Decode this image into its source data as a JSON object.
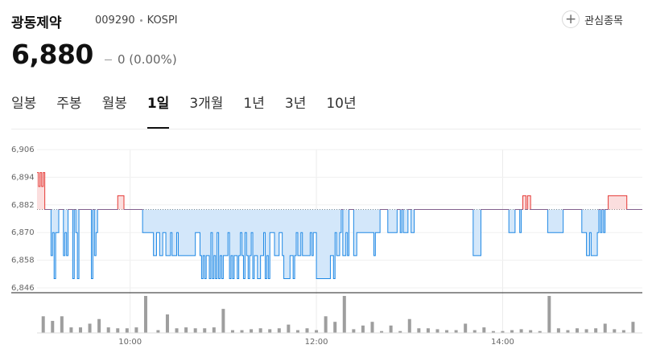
{
  "stock": {
    "name": "광동제약",
    "code": "009290",
    "market": "KOSPI",
    "price": "6,880",
    "change": "0 (0.00%)"
  },
  "actions": {
    "watchlist_label": "관심종목"
  },
  "tabs": [
    {
      "label": "일봉",
      "active": false
    },
    {
      "label": "주봉",
      "active": false
    },
    {
      "label": "월봉",
      "active": false
    },
    {
      "label": "1일",
      "active": true
    },
    {
      "label": "3개월",
      "active": false
    },
    {
      "label": "1년",
      "active": false
    },
    {
      "label": "3년",
      "active": false
    },
    {
      "label": "10년",
      "active": false
    }
  ],
  "colors": {
    "up": "#e53935",
    "down": "#1e88e5",
    "down_fill": "#d3e7fa",
    "up_fill": "#fbdede",
    "volume": "#9e9e9e"
  },
  "chart_data": {
    "type": "line",
    "title": "",
    "reference_price": 6880,
    "y_ticks": [
      "6,906",
      "6,894",
      "6,882",
      "6,870",
      "6,858",
      "6,846"
    ],
    "x_ticks": [
      "10:00",
      "12:00",
      "14:00"
    ],
    "ylim": [
      6846,
      6906
    ],
    "xlim": [
      "09:00",
      "15:30"
    ],
    "grid": true,
    "price_series": {
      "name": "",
      "x": [
        0,
        1,
        2,
        3,
        4,
        5,
        6,
        7,
        8,
        9,
        10,
        11,
        12,
        13,
        14,
        15,
        16,
        17,
        18,
        19,
        20,
        21,
        22,
        23,
        24,
        25,
        26,
        27,
        28,
        29,
        30,
        31,
        32,
        33,
        34,
        35,
        36,
        37,
        38,
        39,
        40,
        41,
        42,
        43,
        44,
        45,
        46,
        47,
        48,
        49,
        50,
        51,
        52,
        53,
        54,
        55,
        56,
        57,
        58,
        59,
        60,
        61,
        62,
        63,
        64,
        65,
        66,
        67,
        68,
        69,
        70,
        71,
        72,
        73,
        74,
        75,
        76,
        77,
        78,
        79,
        80,
        81,
        82,
        83,
        84,
        85,
        86,
        87,
        88,
        89,
        90,
        91,
        92,
        93,
        94,
        95,
        96,
        97,
        98,
        99,
        100,
        101,
        102,
        103,
        104,
        105,
        106,
        107,
        108,
        109,
        110,
        111,
        112,
        113,
        114,
        115,
        116,
        117,
        118,
        119,
        120,
        121,
        122,
        123,
        124,
        125,
        126,
        127,
        128,
        129,
        130,
        131,
        132,
        133,
        134,
        135,
        136,
        137,
        138,
        139,
        140,
        141,
        142,
        143,
        144,
        145,
        146,
        147,
        148,
        149,
        150,
        151,
        152,
        153,
        154,
        155,
        156,
        157,
        158,
        159,
        160,
        161,
        162,
        163,
        164,
        165,
        166,
        167,
        168,
        169,
        170,
        171,
        172,
        173,
        174,
        175,
        176,
        177,
        178,
        179,
        180,
        181,
        182,
        183,
        184,
        185,
        186,
        187,
        188,
        189,
        190,
        191,
        192,
        193,
        194,
        195,
        196,
        197,
        198,
        199,
        200,
        201,
        202,
        203,
        204,
        205,
        206,
        207,
        208,
        209,
        210,
        211,
        212,
        213,
        214,
        215,
        216,
        217,
        218,
        219,
        220,
        221,
        222,
        223,
        224,
        225,
        226,
        227,
        228,
        229,
        230,
        231,
        232,
        233,
        234,
        235,
        236,
        237,
        238,
        239,
        240,
        241,
        242,
        243,
        244,
        245,
        246,
        247,
        248,
        249,
        250,
        251,
        252,
        253,
        254,
        255,
        256,
        257,
        258,
        259,
        260,
        261,
        262,
        263,
        264,
        265,
        266,
        267,
        268,
        269,
        270,
        271,
        272,
        273,
        274,
        275,
        276,
        277,
        278,
        279,
        280,
        281,
        282,
        283,
        284,
        285,
        286,
        287,
        288,
        289,
        290,
        291,
        292,
        293,
        294,
        295,
        296,
        297,
        298,
        299,
        300,
        301,
        302,
        303,
        304,
        305,
        306,
        307,
        308,
        309,
        310,
        311,
        312,
        313,
        314,
        315,
        316,
        317,
        318,
        319,
        320,
        321,
        322,
        323,
        324,
        325,
        326,
        327,
        328,
        329,
        330,
        331,
        332,
        333,
        334,
        335,
        336,
        337,
        338,
        339,
        340,
        341,
        342,
        343,
        344,
        345,
        346,
        347,
        348,
        349,
        350,
        351,
        352,
        353,
        354,
        355,
        356,
        357,
        358,
        359,
        360,
        361,
        362,
        363,
        364,
        365,
        366,
        367,
        368,
        369,
        370,
        371,
        372,
        373,
        374,
        375,
        376,
        377,
        378,
        379,
        380,
        381,
        382,
        383,
        384,
        385,
        386,
        387,
        388,
        389,
        390
      ],
      "y": [
        6896,
        6890,
        6896,
        6890,
        6896,
        6880,
        6880,
        6880,
        6880,
        6860,
        6870,
        6850,
        6870,
        6870,
        6880,
        6880,
        6880,
        6860,
        6870,
        6860,
        6880,
        6880,
        6880,
        6850,
        6880,
        6870,
        6850,
        6880,
        6880,
        6880,
        6880,
        6880,
        6880,
        6880,
        6880,
        6850,
        6880,
        6860,
        6870,
        6880,
        6880,
        6880,
        6880,
        6880,
        6880,
        6880,
        6880,
        6880,
        6880,
        6880,
        6880,
        6880,
        6886,
        6886,
        6886,
        6886,
        6880,
        6880,
        6880,
        6880,
        6880,
        6880,
        6880,
        6880,
        6880,
        6880,
        6880,
        6880,
        6870,
        6870,
        6870,
        6870,
        6870,
        6870,
        6870,
        6860,
        6860,
        6870,
        6870,
        6860,
        6860,
        6870,
        6870,
        6860,
        6860,
        6860,
        6870,
        6860,
        6860,
        6860,
        6870,
        6860,
        6860,
        6860,
        6860,
        6860,
        6860,
        6860,
        6860,
        6860,
        6860,
        6860,
        6870,
        6870,
        6870,
        6860,
        6850,
        6860,
        6850,
        6860,
        6860,
        6850,
        6870,
        6850,
        6860,
        6850,
        6870,
        6850,
        6860,
        6850,
        6860,
        6860,
        6860,
        6870,
        6850,
        6860,
        6850,
        6860,
        6860,
        6850,
        6860,
        6870,
        6860,
        6850,
        6870,
        6860,
        6850,
        6860,
        6870,
        6850,
        6860,
        6860,
        6850,
        6850,
        6860,
        6860,
        6870,
        6850,
        6860,
        6850,
        6870,
        6870,
        6870,
        6860,
        6860,
        6860,
        6870,
        6870,
        6860,
        6850,
        6850,
        6850,
        6850,
        6860,
        6860,
        6850,
        6860,
        6870,
        6860,
        6860,
        6870,
        6860,
        6860,
        6860,
        6860,
        6860,
        6870,
        6860,
        6870,
        6870,
        6850,
        6850,
        6850,
        6850,
        6850,
        6850,
        6850,
        6850,
        6850,
        6860,
        6860,
        6850,
        6870,
        6860,
        6860,
        6870,
        6880,
        6860,
        6860,
        6870,
        6860,
        6880,
        6880,
        6880,
        6860,
        6860,
        6870,
        6870,
        6870,
        6870,
        6870,
        6870,
        6870,
        6870,
        6870,
        6870,
        6870,
        6860,
        6870,
        6870,
        6870,
        6880,
        6880,
        6880,
        6880,
        6880,
        6870,
        6870,
        6870,
        6870,
        6870,
        6870,
        6880,
        6880,
        6870,
        6880,
        6870,
        6870,
        6870,
        6880,
        6880,
        6870,
        6870,
        6880,
        6880,
        6880,
        6880,
        6880,
        6880,
        6880,
        6880,
        6880,
        6880,
        6880,
        6880,
        6880,
        6880,
        6880,
        6880,
        6880,
        6880,
        6880,
        6880,
        6880,
        6880,
        6880,
        6880,
        6880,
        6880,
        6880,
        6880,
        6880,
        6880,
        6880,
        6880,
        6880,
        6880,
        6880,
        6880,
        6880,
        6880,
        6860,
        6860,
        6860,
        6860,
        6860,
        6880,
        6880,
        6880,
        6880,
        6880,
        6880,
        6880,
        6880,
        6880,
        6880,
        6880,
        6880,
        6880,
        6880,
        6880,
        6880,
        6880,
        6880,
        6870,
        6870,
        6870,
        6870,
        6880,
        6880,
        6880,
        6870,
        6880,
        6886,
        6886,
        6880,
        6886,
        6886,
        6880,
        6880,
        6880,
        6880,
        6880,
        6880,
        6880,
        6880,
        6880,
        6880,
        6880,
        6870,
        6870,
        6870,
        6870,
        6870,
        6870,
        6870,
        6870,
        6870,
        6870,
        6880,
        6880,
        6880,
        6880,
        6880,
        6880,
        6880,
        6880,
        6880,
        6880,
        6880,
        6880,
        6870,
        6870,
        6870,
        6860,
        6860,
        6870,
        6860,
        6860,
        6860,
        6860,
        6870,
        6880,
        6870,
        6880,
        6870,
        6880,
        6880,
        6886,
        6886,
        6886,
        6886,
        6886,
        6886,
        6886,
        6886,
        6886,
        6886,
        6886,
        6886,
        6880,
        6880,
        6880,
        6880,
        6880,
        6880,
        6880,
        6880,
        6880,
        6880
      ]
    },
    "volume_series": {
      "name": "",
      "x": [
        4,
        10,
        16,
        22,
        28,
        34,
        40,
        46,
        52,
        58,
        64,
        70,
        78,
        84,
        90,
        96,
        102,
        108,
        114,
        120,
        126,
        132,
        138,
        144,
        150,
        156,
        162,
        168,
        174,
        180,
        186,
        192,
        198,
        204,
        210,
        216,
        222,
        228,
        234,
        240,
        246,
        252,
        258,
        264,
        270,
        276,
        282,
        288,
        294,
        300,
        306,
        312,
        318,
        324,
        330,
        336,
        342,
        348,
        354,
        360,
        366,
        372,
        378,
        384
      ],
      "values": [
        18,
        13,
        18,
        6,
        6,
        10,
        15,
        6,
        5,
        5,
        6,
        40,
        3,
        20,
        5,
        6,
        5,
        5,
        6,
        26,
        3,
        3,
        4,
        5,
        4,
        5,
        9,
        3,
        5,
        3,
        18,
        12,
        40,
        4,
        8,
        12,
        2,
        8,
        2,
        15,
        5,
        5,
        4,
        3,
        3,
        10,
        3,
        6,
        2,
        2,
        3,
        4,
        3,
        2,
        40,
        5,
        3,
        5,
        4,
        5,
        10,
        4,
        3,
        12
      ]
    }
  }
}
